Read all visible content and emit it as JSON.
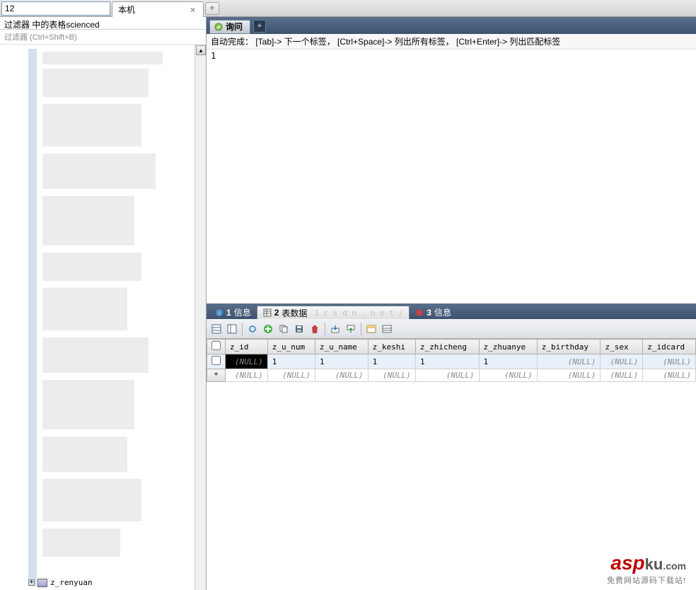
{
  "top": {
    "input_value": "12",
    "tab1": "本机",
    "add": "+"
  },
  "sidebar": {
    "filter_header": "过滤器 中的表格scienced",
    "filter_hint": "过滤器 (Ctrl+Shift+B)",
    "tree_item": "z_renyuan"
  },
  "query": {
    "tab_label": "询问",
    "add": "+",
    "hint": "自动完成： [Tab]-> 下一个标签， [Ctrl+Space]-> 列出所有标签， [Ctrl+Enter]-> 列出匹配标签",
    "content": "1"
  },
  "result_tabs": [
    {
      "num": "1",
      "label": "信息"
    },
    {
      "num": "2",
      "label": "表数据"
    },
    {
      "num": "3",
      "label": "信息"
    }
  ],
  "columns": [
    "z_id",
    "z_u_num",
    "z_u_name",
    "z_keshi",
    "z_zhicheng",
    "z_zhuanye",
    "z_birthday",
    "z_sex",
    "z_idcard"
  ],
  "rows": [
    {
      "marker": "",
      "sel": true,
      "cells": [
        "(NULL)",
        "1",
        "1",
        "1",
        "1",
        "1",
        "(NULL)",
        "(NULL)",
        "(NULL)"
      ]
    },
    {
      "marker": "*",
      "sel": false,
      "cells": [
        "(NULL)",
        "(NULL)",
        "(NULL)",
        "(NULL)",
        "(NULL)",
        "(NULL)",
        "(NULL)",
        "(NULL)",
        "(NULL)"
      ]
    }
  ],
  "watermark": {
    "brand": "asp",
    "suffix": "ku",
    "tld": ".com",
    "sub": "免费网站源码下载站!"
  },
  "mid_watermark": "1  c s d n . n e t /"
}
